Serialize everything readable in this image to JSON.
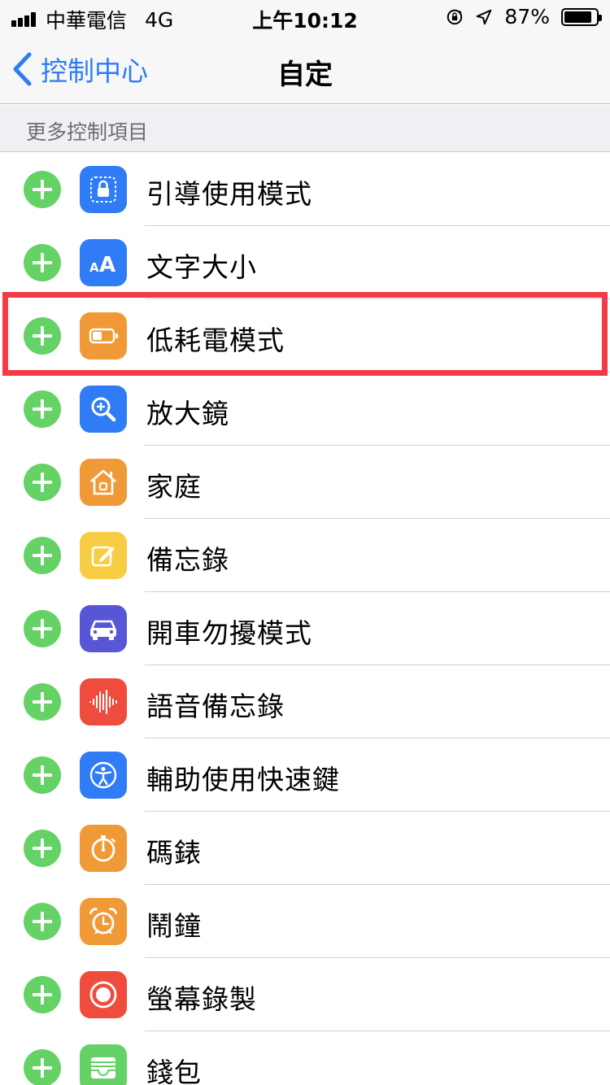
{
  "status_bar": {
    "carrier": "中華電信",
    "network": "4G",
    "time": "上午10:12",
    "battery_percent": "87%",
    "battery_level": 0.87,
    "icons": [
      "signal-bars-icon",
      "orientation-lock-icon",
      "location-arrow-icon",
      "battery-icon"
    ]
  },
  "nav": {
    "back_label": "控制中心",
    "title": "自定"
  },
  "section": {
    "header": "更多控制項目"
  },
  "colors": {
    "accent_blue": "#2f7cf6",
    "add_green": "#65d266",
    "highlight_red": "#f23b46"
  },
  "items": [
    {
      "label": "引導使用模式",
      "icon": "guided-access-icon",
      "color": "#2f7cf6"
    },
    {
      "label": "文字大小",
      "icon": "text-size-icon",
      "color": "#2f7cf6"
    },
    {
      "label": "低耗電模式",
      "icon": "low-power-battery-icon",
      "color": "#f09a37"
    },
    {
      "label": "放大鏡",
      "icon": "magnifier-icon",
      "color": "#2f7cf6"
    },
    {
      "label": "家庭",
      "icon": "home-icon",
      "color": "#f09a37"
    },
    {
      "label": "備忘錄",
      "icon": "notes-icon",
      "color": "#f7cd44"
    },
    {
      "label": "開車勿擾模式",
      "icon": "car-icon",
      "color": "#5856d6"
    },
    {
      "label": "語音備忘錄",
      "icon": "voice-memo-icon",
      "color": "#f04c3e"
    },
    {
      "label": "輔助使用快速鍵",
      "icon": "accessibility-icon",
      "color": "#2f7cf6"
    },
    {
      "label": "碼錶",
      "icon": "stopwatch-icon",
      "color": "#f09a37"
    },
    {
      "label": "鬧鐘",
      "icon": "alarm-icon",
      "color": "#f09a37"
    },
    {
      "label": "螢幕錄製",
      "icon": "screen-record-icon",
      "color": "#f04c3e"
    },
    {
      "label": "錢包",
      "icon": "wallet-icon",
      "color": "#65d266"
    }
  ]
}
